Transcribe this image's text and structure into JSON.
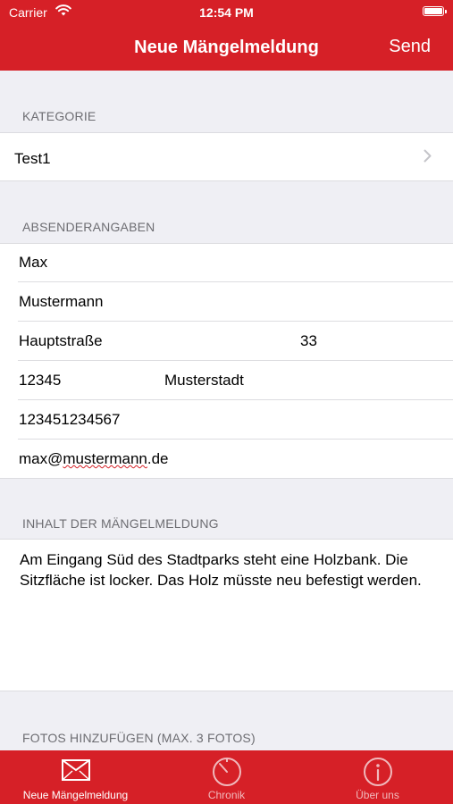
{
  "status": {
    "carrier": "Carrier",
    "time": "12:54 PM"
  },
  "nav": {
    "title": "Neue Mängelmeldung",
    "send_label": "Send"
  },
  "kategorie": {
    "header": "KATEGORIE",
    "value": "Test1"
  },
  "absender": {
    "header": "ABSENDERANGABEN",
    "first_name": "Max",
    "last_name": "Mustermann",
    "street": "Hauptstraße",
    "house_number": "33",
    "zip": "12345",
    "city": "Musterstadt",
    "phone": "123451234567",
    "email_prefix": "max@",
    "email_marked": "mustermann",
    "email_suffix": ".de"
  },
  "inhalt": {
    "header": "INHALT DER MÄNGELMELDUNG",
    "text": "Am Eingang Süd des Stadtparks steht eine Holzbank. Die Sitzfläche ist locker. Das Holz müsste neu befestigt werden."
  },
  "fotos": {
    "header": "FOTOS HINZUFÜGEN (MAX. 3 FOTOS)"
  },
  "tabs": [
    {
      "label": "Neue Mängelmeldung",
      "icon": "envelope-icon"
    },
    {
      "label": "Chronik",
      "icon": "timer-icon"
    },
    {
      "label": "Über uns",
      "icon": "info-icon"
    }
  ],
  "colors": {
    "brand_red": "#d62027",
    "background": "#efeff4",
    "inactive_tab": "#f0b9bc"
  }
}
